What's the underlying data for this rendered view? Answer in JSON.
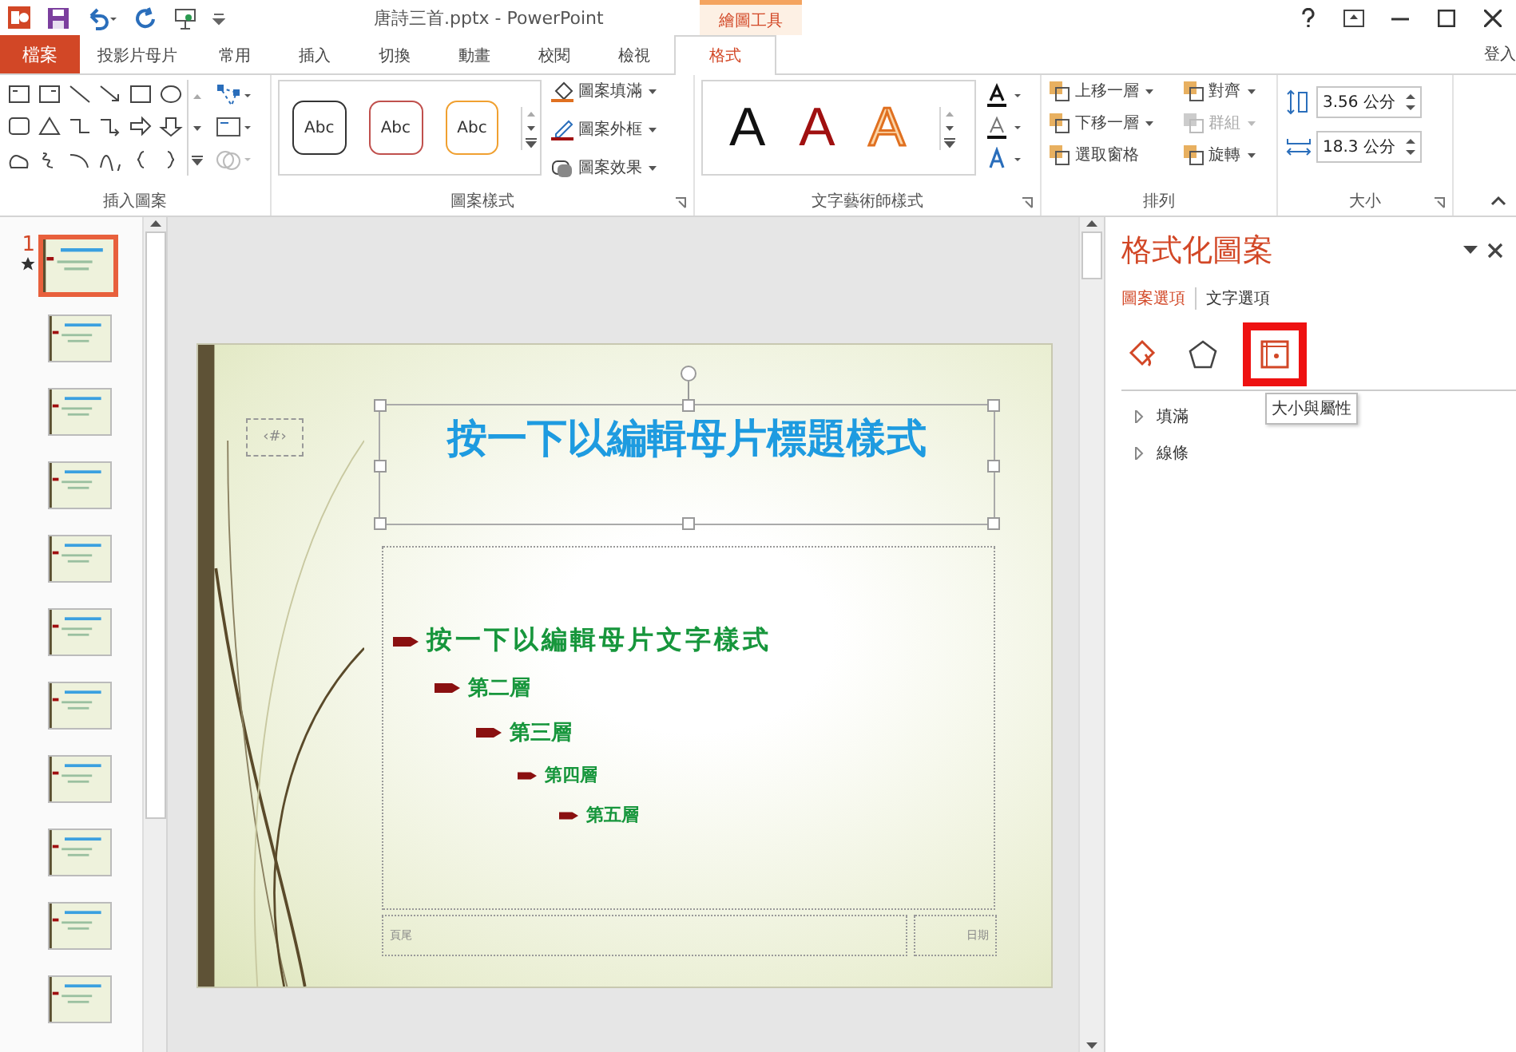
{
  "window": {
    "title": "唐詩三首.pptx - PowerPoint",
    "context_group": "繪圖工具",
    "sign_in": "登入"
  },
  "file_tab": "檔案",
  "tabs": [
    {
      "label": "投影片母片",
      "selected": false
    },
    {
      "label": "常用",
      "selected": false
    },
    {
      "label": "插入",
      "selected": false
    },
    {
      "label": "切換",
      "selected": false
    },
    {
      "label": "動畫",
      "selected": false
    },
    {
      "label": "校閱",
      "selected": false
    },
    {
      "label": "檢視",
      "selected": false
    },
    {
      "label": "格式",
      "selected": true
    }
  ],
  "ribbon": {
    "insert_shapes": {
      "label": "插入圖案"
    },
    "shape_styles": {
      "label": "圖案樣式",
      "presets": [
        {
          "text": "Abc",
          "color": "#333333"
        },
        {
          "text": "Abc",
          "color": "#c0504d"
        },
        {
          "text": "Abc",
          "color": "#f0a030"
        }
      ],
      "commands": [
        "圖案填滿",
        "圖案外框",
        "圖案效果"
      ]
    },
    "wordart": {
      "label": "文字藝術師樣式",
      "presets": [
        {
          "text": "A",
          "kind": "solid"
        },
        {
          "text": "A",
          "kind": "red"
        },
        {
          "text": "A",
          "kind": "outline"
        }
      ]
    },
    "arrange": {
      "label": "排列",
      "commands": [
        {
          "label": "上移一層",
          "disabled": false
        },
        {
          "label": "對齊",
          "disabled": false
        },
        {
          "label": "下移一層",
          "disabled": false
        },
        {
          "label": "群組",
          "disabled": true
        },
        {
          "label": "選取窗格",
          "disabled": false
        },
        {
          "label": "旋轉",
          "disabled": false
        }
      ]
    },
    "size": {
      "label": "大小",
      "fields": [
        {
          "value": "3.56 公分"
        },
        {
          "value": "18.3 公分"
        }
      ]
    }
  },
  "thumbnails": [
    {
      "number": "1",
      "selected": true
    },
    {
      "selected": false
    },
    {
      "selected": false
    },
    {
      "selected": false
    },
    {
      "selected": false
    },
    {
      "selected": false
    },
    {
      "selected": false
    },
    {
      "selected": false
    },
    {
      "selected": false
    },
    {
      "selected": false
    },
    {
      "selected": false
    }
  ],
  "slide": {
    "title": "按一下以編輯母片標題樣式",
    "slide_number": "‹#›",
    "footer": "頁尾",
    "date": "日期",
    "body": [
      {
        "text": "按一下以編輯母片文字樣式",
        "children": [
          {
            "text": "第二層",
            "children": [
              {
                "text": "第三層",
                "children": [
                  {
                    "text": "第四層",
                    "children": [
                      {
                        "text": "第五層"
                      }
                    ]
                  }
                ]
              }
            ]
          }
        ]
      }
    ]
  },
  "pane": {
    "title": "格式化圖案",
    "tabs": [
      {
        "label": "圖案選項",
        "selected": true
      },
      {
        "label": "文字選項",
        "selected": false
      }
    ],
    "icons": [
      {
        "kind": "fill",
        "selected": false
      },
      {
        "kind": "effects",
        "selected": false
      },
      {
        "kind": "size",
        "selected": true
      }
    ],
    "tooltip": "大小與屬性",
    "sections": [
      {
        "label": "填滿",
        "expanded": false
      },
      {
        "label": "線條",
        "expanded": false
      }
    ]
  }
}
